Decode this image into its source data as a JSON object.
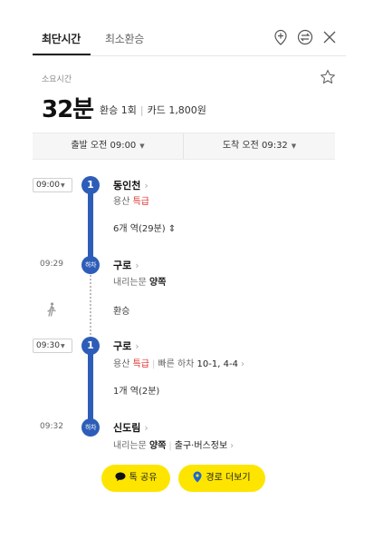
{
  "tabs": {
    "active": "최단시간",
    "inactive": "최소환승"
  },
  "summary": {
    "duration_label": "소요시간",
    "duration": "32분",
    "transfers": "환승 1회",
    "fare": "카드 1,800원"
  },
  "timebar": {
    "depart": "출발 오전 09:00",
    "arrive": "도착 오전 09:32"
  },
  "steps": {
    "s1": {
      "time": "09:00",
      "node": "1",
      "station": "동인천",
      "line": "용산",
      "express": "특급",
      "stops": "6개 역(29분)"
    },
    "s2": {
      "time": "09:29",
      "node": "하차",
      "station": "구로",
      "door_label": "내리는문",
      "door": "양쪽"
    },
    "walk": {
      "label": "환승"
    },
    "s3": {
      "time": "09:30",
      "node": "1",
      "station": "구로",
      "line": "용산",
      "express": "특급",
      "fast_label": "빠른 하차",
      "fast": "10-1, 4-4",
      "stops": "1개 역(2분)"
    },
    "s4": {
      "time": "09:32",
      "node": "하차",
      "station": "신도림",
      "door_label": "내리는문",
      "door": "양쪽",
      "exit_info": "출구·버스정보"
    }
  },
  "buttons": {
    "share": "톡 공유",
    "more_route": "경로 더보기"
  },
  "colors": {
    "line": "#2d5db8",
    "express": "#e0322f",
    "button": "#fee500"
  }
}
